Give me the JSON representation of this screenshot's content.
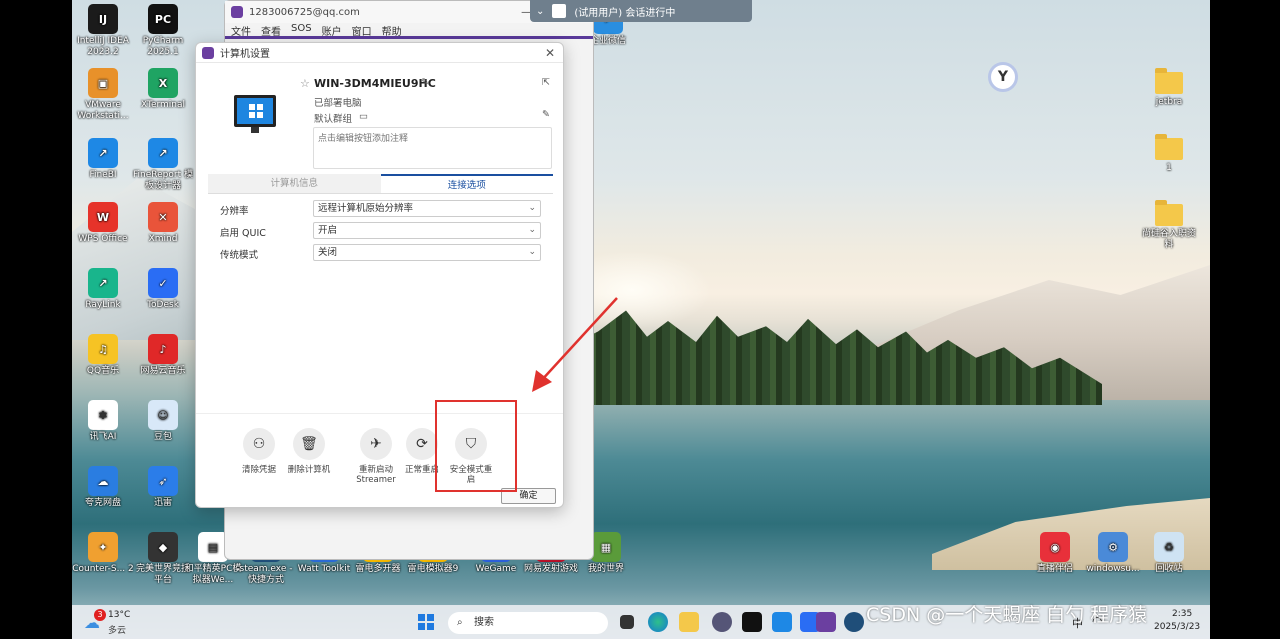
{
  "desktop_icons": [
    {
      "label": "IntelliJ IDEA 2023.2",
      "icon": "intellij-icon",
      "color": "#1b1b1b",
      "glyph": "IJ"
    },
    {
      "label": "PyCharm 2025.1",
      "icon": "pycharm-icon",
      "color": "#111111",
      "glyph": "PC"
    },
    {
      "label": "VMware Workstati...",
      "icon": "vmware-icon",
      "color": "#e8912a",
      "glyph": "▣"
    },
    {
      "label": "XTerminal",
      "icon": "xterminal-icon",
      "color": "#1fa463",
      "glyph": "X"
    },
    {
      "label": "FineBI",
      "icon": "finebi-icon",
      "color": "#1e88e5",
      "glyph": "↗"
    },
    {
      "label": "FineReport 模板设计器",
      "icon": "finereport-icon",
      "color": "#1e88e5",
      "glyph": "↗"
    },
    {
      "label": "WPS Office",
      "icon": "wps-icon",
      "color": "#e6332a",
      "glyph": "W"
    },
    {
      "label": "Xmind",
      "icon": "xmind-icon",
      "color": "#e9543a",
      "glyph": "✕"
    },
    {
      "label": "RayLink",
      "icon": "raylink-icon",
      "color": "#19b58c",
      "glyph": "↗"
    },
    {
      "label": "ToDesk",
      "icon": "todesk-icon",
      "color": "#2a6df4",
      "glyph": "✓"
    },
    {
      "label": "QQ音乐",
      "icon": "qqmusic-icon",
      "color": "#f6c324",
      "glyph": "♫"
    },
    {
      "label": "网易云音乐",
      "icon": "netease-music-icon",
      "color": "#e02828",
      "glyph": "♪"
    },
    {
      "label": "讯飞AI",
      "icon": "xunfei-icon",
      "color": "#ffffff",
      "glyph": "✱"
    },
    {
      "label": "豆包",
      "icon": "doubao-icon",
      "color": "#d8e8f8",
      "glyph": "☺"
    },
    {
      "label": "夸克网盘",
      "icon": "quark-icon",
      "color": "#2a7de1",
      "glyph": "☁"
    },
    {
      "label": "迅雷",
      "icon": "xunlei-icon",
      "color": "#2b7de9",
      "glyph": "➶"
    },
    {
      "label": "Counter-S... 2",
      "icon": "csgo-icon",
      "color": "#f0a030",
      "glyph": "✦"
    },
    {
      "label": "完美世界竞技平台",
      "icon": "perfect-world-icon",
      "color": "#333333",
      "glyph": "◆"
    },
    {
      "label": "和平精英PC模拟器We...",
      "icon": "pubg-file-icon",
      "color": "#ffffff",
      "glyph": "▤"
    },
    {
      "label": "steam.exe - 快捷方式",
      "icon": "steam-icon",
      "color": "#1f4e79",
      "glyph": "↗"
    },
    {
      "label": "Watt Toolkit",
      "icon": "watt-icon",
      "color": "#2a6ad4",
      "glyph": "↗"
    },
    {
      "label": "雷电多开器",
      "icon": "ldmulti-icon",
      "color": "#f5b800",
      "glyph": "↗"
    },
    {
      "label": "雷电模拟器9",
      "icon": "ldplayer-icon",
      "color": "#f5b800",
      "glyph": "↗"
    },
    {
      "label": "WeGame",
      "icon": "wegame-icon",
      "color": "#2b5fd9",
      "glyph": "↗"
    },
    {
      "label": "网易发射游戏",
      "icon": "netease-game-icon",
      "color": "#b8122a",
      "glyph": "◣"
    },
    {
      "label": "我的世界",
      "icon": "minecraft-icon",
      "color": "#5a9b3a",
      "glyph": "▦"
    },
    {
      "label": "企业微信",
      "icon": "wecom-icon",
      "color": "#2a8ee0",
      "glyph": "↗"
    },
    {
      "label": "jetbra",
      "icon": "folder-icon",
      "color": "#f4c84a",
      "glyph": ""
    },
    {
      "label": "1",
      "icon": "folder-icon",
      "color": "#f4c84a",
      "glyph": ""
    },
    {
      "label": "尚硅谷入职资料",
      "icon": "folder-icon",
      "color": "#f4c84a",
      "glyph": ""
    },
    {
      "label": "直播伴侣",
      "icon": "live-assist-icon",
      "color": "#e8303a",
      "glyph": "◉"
    },
    {
      "label": "windowsu...",
      "icon": "windows-update-icon",
      "color": "#4a8ad8",
      "glyph": "⚙"
    },
    {
      "label": "回收站",
      "icon": "recycle-bin-icon",
      "color": "#cfe3f3",
      "glyph": "♻"
    }
  ],
  "back_window": {
    "account": "1283006725@qq.com",
    "menu": [
      "文件",
      "查看",
      "SOS",
      "账户",
      "窗口",
      "帮助"
    ]
  },
  "session_bar": {
    "text": "(试用用户) 会话进行中"
  },
  "dialog": {
    "title": "计算机设置",
    "hostname": "WIN-3DM4MIEU9HC",
    "deployed": "已部署电脑",
    "group": "默认群组",
    "note_placeholder": "点击编辑按钮添加注释",
    "tabs": [
      "计算机信息",
      "连接选项"
    ],
    "active_tab": "连接选项",
    "options": [
      {
        "label": "分辨率",
        "value": "远程计算机原始分辨率"
      },
      {
        "label": "启用 QUIC",
        "value": "开启"
      },
      {
        "label": "传统模式",
        "value": "关闭"
      }
    ],
    "actions": [
      {
        "label": "清除凭据",
        "icon": "person-icon"
      },
      {
        "label": "删除计算机",
        "icon": "trash-icon"
      },
      {
        "label": "重新启动 Streamer",
        "icon": "restart-streamer-icon"
      },
      {
        "label": "正常重启",
        "icon": "restart-icon"
      },
      {
        "label": "安全模式重启",
        "icon": "shield-icon"
      }
    ],
    "ok_label": "确定"
  },
  "taskbar": {
    "weather_temp": "13°C",
    "weather_desc": "多云",
    "weather_badge": "3",
    "search_placeholder": "搜索",
    "time": "2:35",
    "date": "2025/3/23",
    "ime": "中"
  },
  "watermark": "CSDN @一个天蝎座 白勺 程序猿",
  "annotation_color": "#e0322e"
}
